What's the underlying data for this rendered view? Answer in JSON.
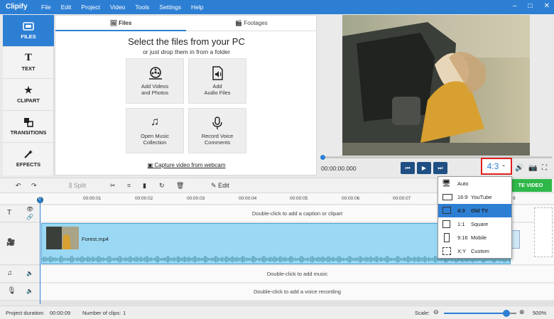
{
  "app": {
    "name": "Clipify",
    "menu": [
      "File",
      "Edit",
      "Project",
      "Video",
      "Tools",
      "Settings",
      "Help"
    ],
    "window_controls": [
      "–",
      "□",
      "✕"
    ]
  },
  "nav": [
    {
      "label": "FILES",
      "icon": "film-icon",
      "active": true
    },
    {
      "label": "TEXT",
      "icon": "text-icon",
      "active": false
    },
    {
      "label": "CLIPART",
      "icon": "star-icon",
      "active": false
    },
    {
      "label": "TRANSITIONS",
      "icon": "transitions-icon",
      "active": false
    },
    {
      "label": "EFFECTS",
      "icon": "wand-icon",
      "active": false
    }
  ],
  "files_panel": {
    "tabs": [
      "Files",
      "Footages"
    ],
    "title": "Select the files from your PC",
    "subtitle": "or just drop them in from a folder",
    "tiles": [
      {
        "line1": "Add Videos",
        "line2": "and Photos",
        "icon": "film-reel-icon"
      },
      {
        "line1": "Add",
        "line2": "Audio Files",
        "icon": "audio-file-icon"
      },
      {
        "line1": "Open Music",
        "line2": "Collection",
        "icon": "music-notes-icon"
      },
      {
        "line1": "Record Voice",
        "line2": "Comments",
        "icon": "microphone-icon"
      }
    ],
    "webcam_link": "Capture video from webcam"
  },
  "player": {
    "timecode": "00:00:00.000",
    "aspect_label": "4:3",
    "progress": 0.0
  },
  "aspect_menu": [
    {
      "ratio": "",
      "label": "Auto",
      "selected": false
    },
    {
      "ratio": "16:9",
      "label": "YouTube",
      "selected": false
    },
    {
      "ratio": "4:3",
      "label": "Old TV",
      "selected": true
    },
    {
      "ratio": "1:1",
      "label": "Square",
      "selected": false
    },
    {
      "ratio": "9:16",
      "label": "Mobile",
      "selected": false
    },
    {
      "ratio": "X:Y",
      "label": "Custom",
      "selected": false
    }
  ],
  "toolbar": {
    "split": "Split",
    "edit": "Edit",
    "create": "CREATE VIDEO",
    "create_visible": "TE VIDEO"
  },
  "ruler": {
    "labels": [
      "0",
      "00:00:01",
      "00:00:02",
      "00:00:03",
      "00:00:04",
      "00:00:05",
      "00:00:06",
      "00:00:07",
      "9"
    ]
  },
  "tracks": {
    "caption_hint": "Double-click to add a caption or clipart",
    "music_hint": "Double-click to add music",
    "voice_hint": "Double-click to add a voice recording",
    "clip_name": "Forest.mp4"
  },
  "status": {
    "duration_label": "Project duration:",
    "duration_value": "00:00:09",
    "clips_label": "Number of clips:",
    "clips_value": "1",
    "scale_label": "Scale:",
    "scale_value": "500%",
    "scale_level": 0.86
  },
  "colors": {
    "accent": "#2d7fd4",
    "create_green": "#2fb84a",
    "clip_fill": "#9bd8f3",
    "highlight_red": "#e02020"
  }
}
